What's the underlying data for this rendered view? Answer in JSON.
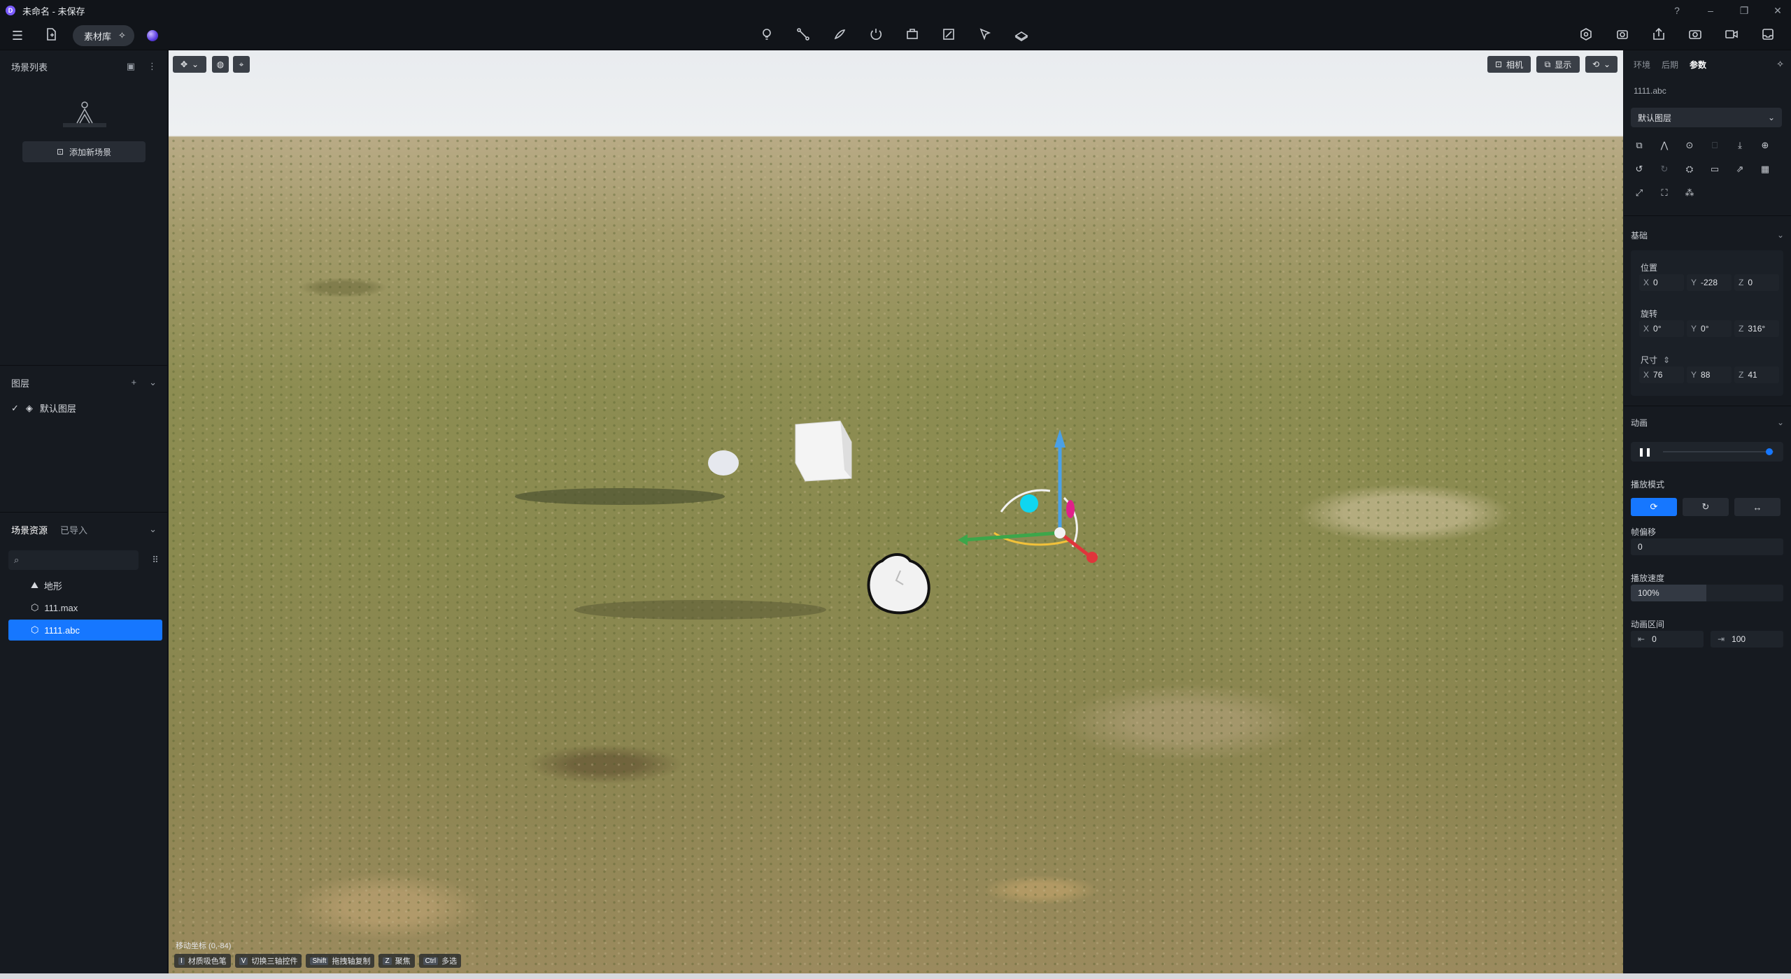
{
  "window": {
    "title": "未命名 - 未保存",
    "logo_letter": "D"
  },
  "toolbar": {
    "library_label": "素材库"
  },
  "left": {
    "scene_list_title": "场景列表",
    "add_scene_label": "添加新场景",
    "layers_title": "图层",
    "layers": [
      {
        "name": "默认图层",
        "checked": true
      }
    ],
    "assets_tab_active": "场景资源",
    "assets_tab_other": "已导入",
    "search_placeholder": "",
    "tree": [
      {
        "name": "地形",
        "icon": "terrain-icon",
        "selected": false
      },
      {
        "name": "111.max",
        "icon": "cube-icon",
        "selected": false
      },
      {
        "name": "1111.abc",
        "icon": "cube-icon",
        "selected": true
      }
    ]
  },
  "viewport": {
    "camera_label": "相机",
    "display_label": "显示",
    "coord_text": "移动坐标 (0,-84)",
    "hints": [
      {
        "key": "I",
        "text": "材质吸色笔"
      },
      {
        "key": "V",
        "text": "切换三轴控件"
      },
      {
        "key": "Shift",
        "text": "拖拽轴复制"
      },
      {
        "key": "Z",
        "text": "聚焦"
      },
      {
        "key": "Ctrl",
        "text": "多选"
      }
    ]
  },
  "right": {
    "tabs": [
      "环境",
      "后期",
      "参数"
    ],
    "active_tab": "参数",
    "object_name": "1111.abc",
    "layer_select": "默认图层",
    "basic_title": "基础",
    "position_label": "位置",
    "position": {
      "x": "0",
      "y": "-228",
      "z": "0"
    },
    "rotation_label": "旋转",
    "rotation": {
      "x": "0°",
      "y": "0°",
      "z": "316°"
    },
    "size_label": "尺寸",
    "size": {
      "x": "76",
      "y": "88",
      "z": "41"
    },
    "animation_title": "动画",
    "animation_progress": 0.96,
    "play_mode_label": "播放模式",
    "frame_offset_label": "帧偏移",
    "frame_offset": "0",
    "speed_label": "播放速度",
    "speed": "100%",
    "range_label": "动画区间",
    "range_start": "0",
    "range_end": "100"
  },
  "colors": {
    "accent": "#1677ff",
    "panel": "#161a20",
    "titlebar": "#111419"
  }
}
